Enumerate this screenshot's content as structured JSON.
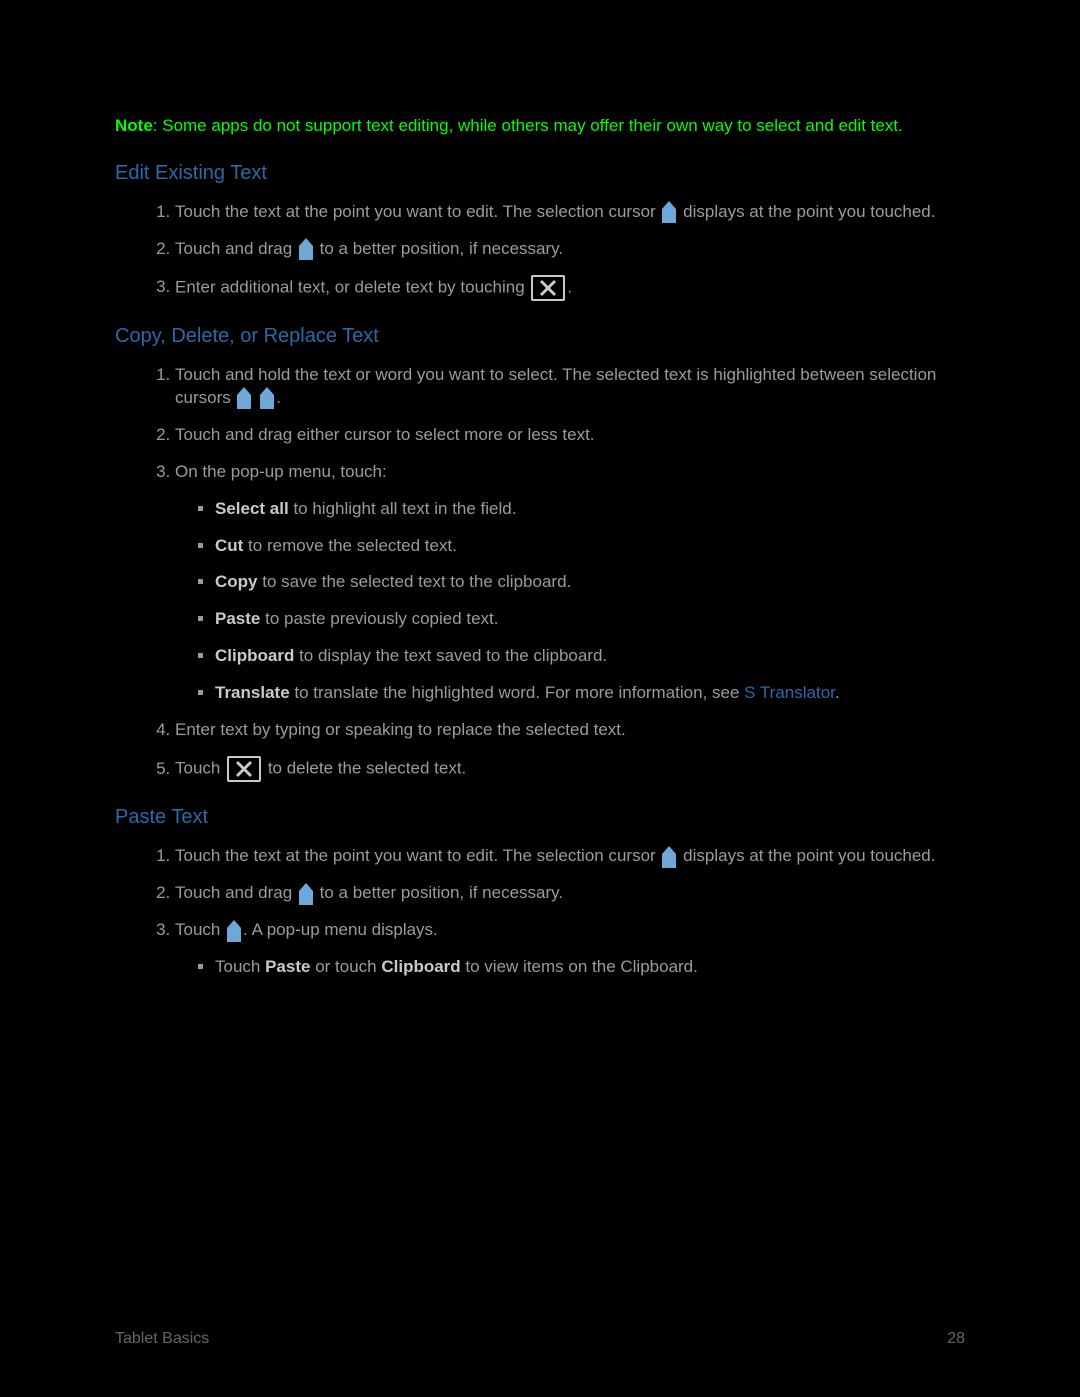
{
  "note": {
    "label": "Note",
    "text": ": Some apps do not support text editing, while others may offer their own way to select and edit text."
  },
  "s1": {
    "heading": "Edit Existing Text",
    "i1a": "Touch the text at the point you want to edit. The selection cursor ",
    "i1b": " displays at the point you touched.",
    "i2a": "Touch and drag ",
    "i2b": " to a better position, if necessary.",
    "i3a": "Enter additional text, or delete text by touching ",
    "i3b": "."
  },
  "s2": {
    "heading": "Copy, Delete, or Replace Text",
    "i1a": "Touch and hold the text or word you want to select. The selected text is highlighted between selection cursors ",
    "i1b": ".",
    "i2": "Touch and drag either cursor to select more or less text.",
    "i3": "On the pop-up menu, touch:",
    "menu": {
      "selectall": {
        "b": "Select all",
        "t": " to highlight all text in the field."
      },
      "cut": {
        "b": "Cut",
        "t": " to remove the selected text."
      },
      "copy": {
        "b": "Copy",
        "t": " to save the selected text to the clipboard."
      },
      "paste": {
        "b": "Paste",
        "t": " to paste previously copied text."
      },
      "clipboard": {
        "b": "Clipboard",
        "t": " to display the text saved to the clipboard."
      },
      "translate": {
        "b": "Translate",
        "t": " to translate the highlighted word. For more information, see ",
        "link": "S Translator",
        "t2": "."
      }
    },
    "i4": "Enter text by typing or speaking to replace the selected text.",
    "i5a": "Touch ",
    "i5b": " to delete the selected text."
  },
  "s3": {
    "heading": "Paste Text",
    "i1a": "Touch the text at the point you want to edit. The selection cursor ",
    "i1b": " displays at the point you touched.",
    "i2a": "Touch and drag ",
    "i2b": " to a better position, if necessary.",
    "i3a": "Touch ",
    "i3b": ". A pop-up menu displays.",
    "sub": {
      "pre": "Touch ",
      "paste": "Paste",
      "mid": " or touch ",
      "clip": "Clipboard",
      "post": " to view items on the Clipboard."
    }
  },
  "footer": {
    "section": "Tablet Basics",
    "page": "28"
  }
}
